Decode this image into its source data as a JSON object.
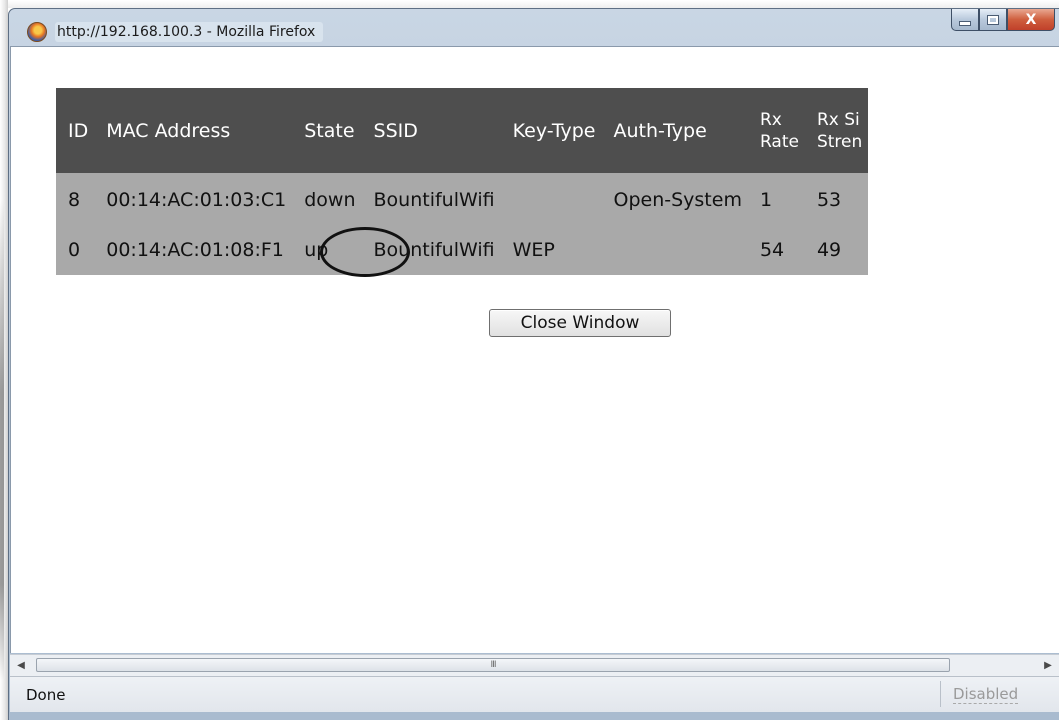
{
  "window": {
    "title": "http://192.168.100.3 - Mozilla Firefox",
    "minimize_label": "—",
    "close_label": "X"
  },
  "table": {
    "headers": [
      "ID",
      "MAC Address",
      "State",
      "SSID",
      "Key-Type",
      "Auth-Type",
      "Rx\nRate",
      "Rx Si\nStren"
    ],
    "rows": [
      [
        "8",
        "00:14:AC:01:03:C1",
        "down",
        "BountifulWifi",
        "",
        "Open-System",
        "1",
        "53"
      ],
      [
        "0",
        "00:14:AC:01:08:F1",
        "up",
        "BountifulWifi",
        "WEP",
        "",
        "54",
        "49"
      ]
    ]
  },
  "close_button": "Close Window",
  "scrollbar": {
    "left_arrow": "◀",
    "right_arrow": "▶",
    "grip": "III"
  },
  "statusbar": {
    "text": "Done",
    "disabled": "Disabled"
  },
  "colors": {
    "table_header": "#4e4e4e",
    "table_body": "#a9a9a9",
    "close_button_red": "#c0402a"
  }
}
